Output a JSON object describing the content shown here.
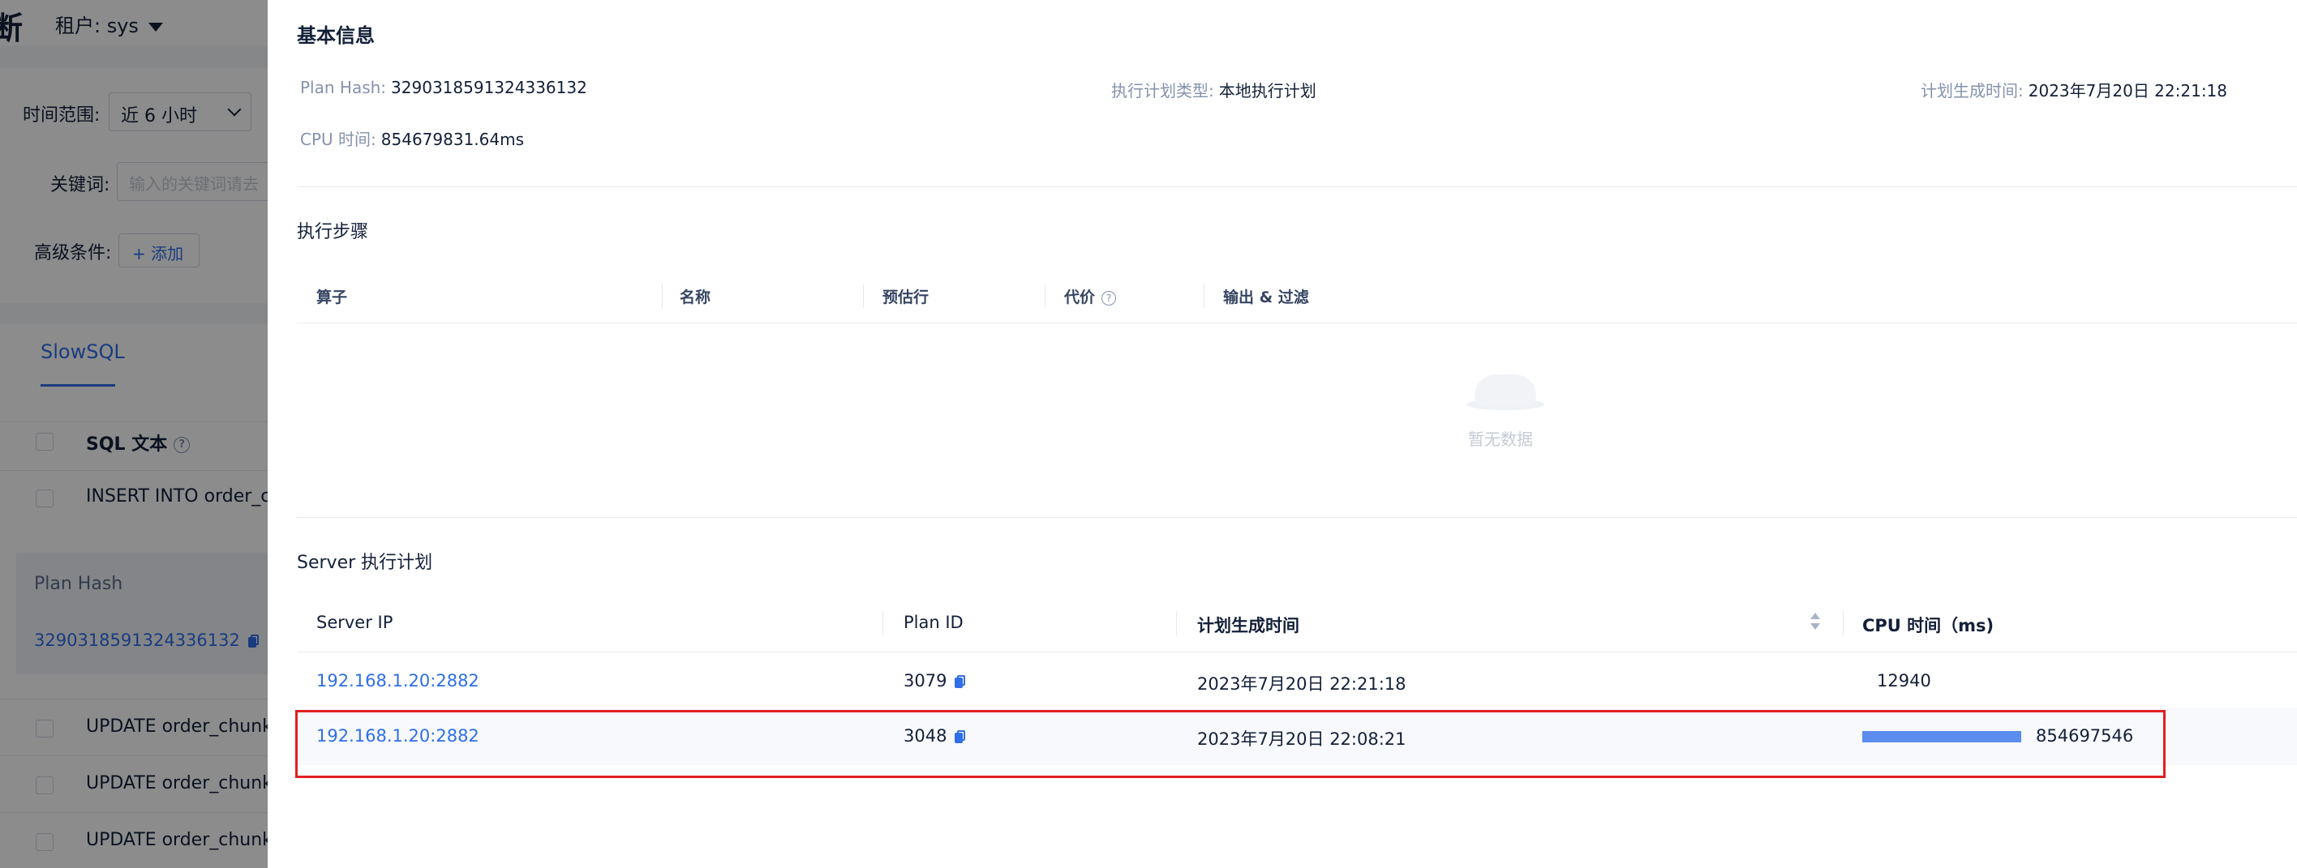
{
  "background": {
    "page_title": "断",
    "tenant_label": "租户: sys",
    "filters": {
      "time_range_label": "时间范围:",
      "time_range_value": "近 6 小时",
      "keyword_label": "关键词:",
      "keyword_placeholder": "输入的关键词请去",
      "advanced_label": "高级条件:",
      "add_button": "+ 添加"
    },
    "tab_slowsql": "SlowSQL",
    "table_header_sql": "SQL 文本",
    "rows": [
      "INSERT INTO order_chur",
      "UPDATE order_chunk SE",
      "UPDATE order_chunk SE",
      "UPDATE order_chunk SE"
    ],
    "plan_hash_label": "Plan Hash",
    "plan_hash_value": "3290318591324336132"
  },
  "drawer": {
    "basic_info_title": "基本信息",
    "plan_hash_key": "Plan Hash:",
    "plan_hash_value": "3290318591324336132",
    "plan_type_key": "执行计划类型:",
    "plan_type_value": "本地执行计划",
    "plan_gen_time_key": "计划生成时间:",
    "plan_gen_time_value": "2023年7月20日 22:21:18",
    "cpu_time_key": "CPU 时间:",
    "cpu_time_value": "854679831.64ms",
    "exec_steps_title": "执行步骤",
    "steps_columns": [
      "算子",
      "名称",
      "预估行",
      "代价",
      "输出 & 过滤"
    ],
    "empty_text": "暂无数据",
    "server_plan_title": "Server 执行计划",
    "server_columns": [
      "Server IP",
      "Plan ID",
      "计划生成时间",
      "CPU 时间（ms)"
    ],
    "server_rows": [
      {
        "ip": "192.168.1.20:2882",
        "plan_id": "3079",
        "time": "2023年7月20日 22:21:18",
        "cpu": "12940"
      },
      {
        "ip": "192.168.1.20:2882",
        "plan_id": "3048",
        "time": "2023年7月20日 22:08:21",
        "cpu": "854697546",
        "cpu_bar_fraction": 1.0
      }
    ],
    "colors": {
      "accent": "#2f6ee7",
      "highlight": "#e02020",
      "bar": "#5b8def"
    }
  }
}
